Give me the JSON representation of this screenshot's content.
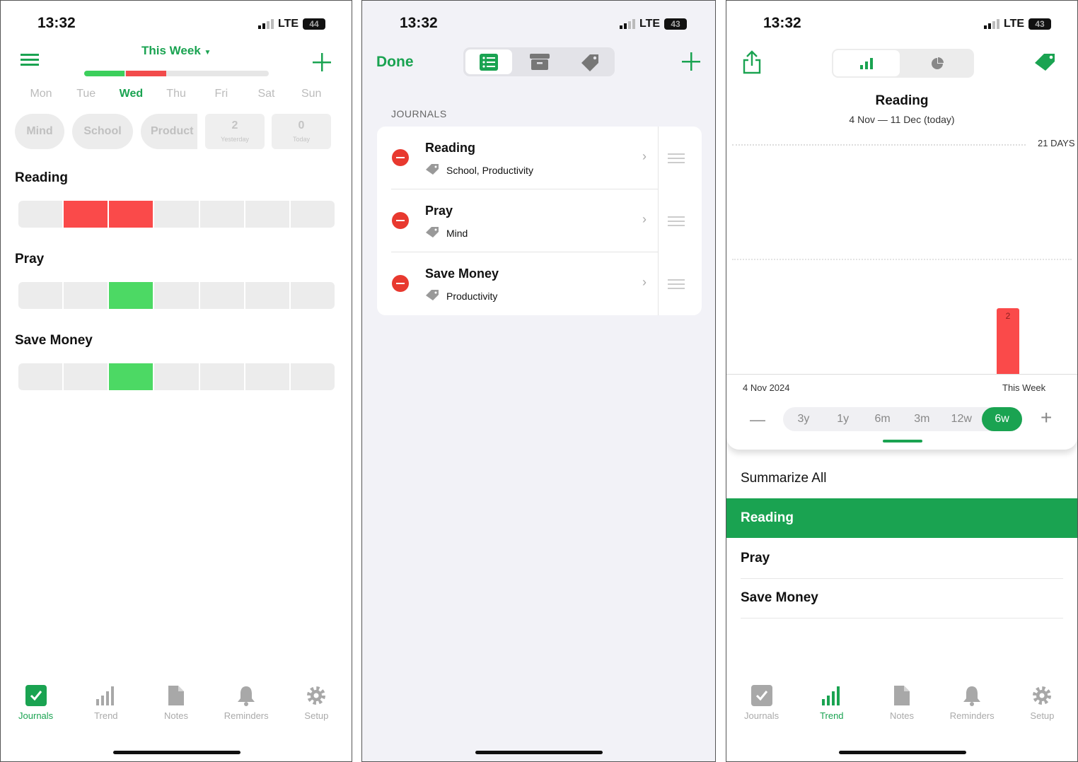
{
  "status": {
    "time": "13:32",
    "network": "LTE",
    "battery_p1": "44",
    "battery_p2": "43",
    "battery_p3": "43"
  },
  "journals_screen": {
    "period": "This Week",
    "week_progress": {
      "green_fraction": 0.22,
      "red_fraction": 0.22
    },
    "days": [
      "Mon",
      "Tue",
      "Wed",
      "Thu",
      "Fri",
      "Sat",
      "Sun"
    ],
    "selected_day": "Wed",
    "filters": [
      "Mind",
      "School",
      "Product"
    ],
    "yesterday": {
      "count": "2",
      "label": "Yesterday"
    },
    "today": {
      "count": "0",
      "label": "Today"
    },
    "journals": [
      {
        "name": "Reading",
        "filled": [
          false,
          true,
          true,
          false,
          false,
          false,
          false
        ],
        "color": "#fa4a4a"
      },
      {
        "name": "Pray",
        "filled": [
          false,
          false,
          true,
          false,
          false,
          false,
          false
        ],
        "color": "#4cd964"
      },
      {
        "name": "Save Money",
        "filled": [
          false,
          false,
          true,
          false,
          false,
          false,
          false
        ],
        "color": "#4cd964"
      }
    ]
  },
  "edit_screen": {
    "done_label": "Done",
    "section_header": "JOURNALS",
    "items": [
      {
        "name": "Reading",
        "tags": "School, Productivity"
      },
      {
        "name": "Pray",
        "tags": "Mind"
      },
      {
        "name": "Save Money",
        "tags": "Productivity"
      }
    ]
  },
  "trend_screen": {
    "title": "Reading",
    "subtitle": "4 Nov — 11 Dec (today)",
    "ranges": [
      "3y",
      "1y",
      "6m",
      "3m",
      "12w",
      "6w"
    ],
    "selected_range": "6w",
    "list": [
      "Summarize All",
      "Reading",
      "Pray",
      "Save Money"
    ],
    "selected_item": "Reading"
  },
  "chart_data": {
    "type": "bar",
    "gridline_label": "21 DAYS",
    "x_start_label": "4 Nov 2024",
    "x_end_label": "This Week",
    "bars": [
      {
        "category": "This Week",
        "value": 2,
        "label": "2",
        "color": "#fa4a4a"
      }
    ]
  },
  "tabbar": [
    {
      "label": "Journals"
    },
    {
      "label": "Trend"
    },
    {
      "label": "Notes"
    },
    {
      "label": "Reminders"
    },
    {
      "label": "Setup"
    }
  ],
  "colors": {
    "accent": "#1aa351",
    "red": "#fa4a4a",
    "light_green": "#4cd964"
  }
}
